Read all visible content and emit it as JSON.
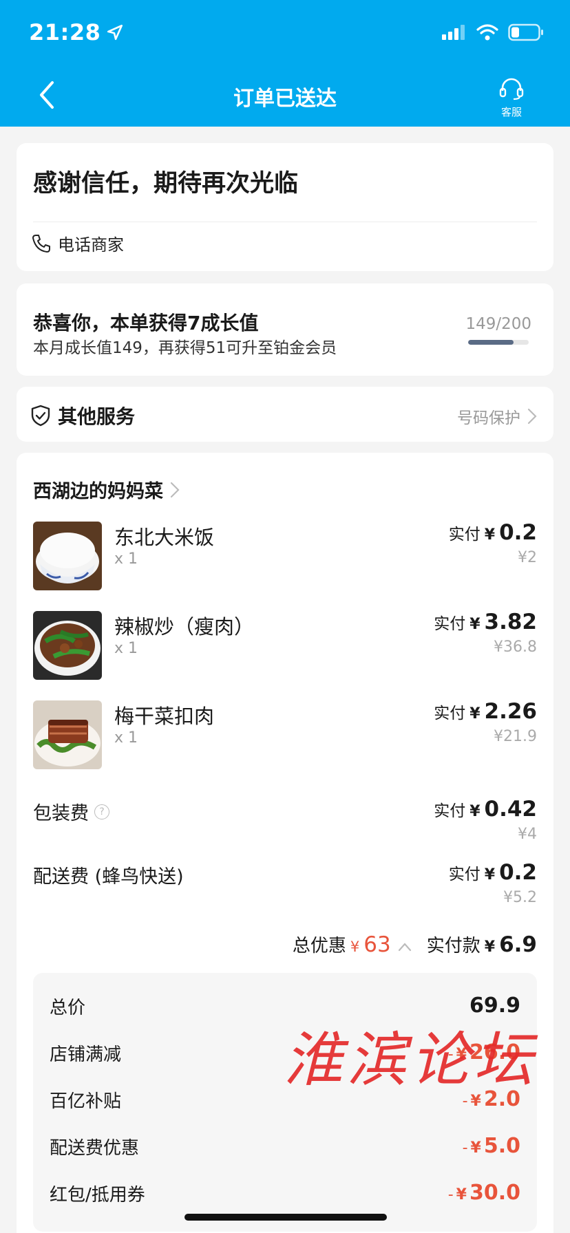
{
  "status_bar": {
    "time": "21:28"
  },
  "nav": {
    "title": "订单已送达",
    "customer_service": "客服"
  },
  "thanks": {
    "title": "感谢信任，期待再次光临",
    "phone_merchant": "电话商家"
  },
  "growth": {
    "title": "恭喜你，本单获得7成长值",
    "subtitle": "本月成长值149，再获得51可升至铂金会员",
    "progress_text": "149/200",
    "progress_fraction": 0.745
  },
  "service": {
    "label": "其他服务",
    "number_protection": "号码保护"
  },
  "order": {
    "shop_name": "西湖边的妈妈菜",
    "paid_label": "实付",
    "yen": "¥",
    "items": [
      {
        "name": "东北大米饭",
        "qty": "x 1",
        "paid": "0.2",
        "original": "¥2"
      },
      {
        "name": "辣椒炒（瘦肉）",
        "qty": "x 1",
        "paid": "3.82",
        "original": "¥36.8"
      },
      {
        "name": "梅干菜扣肉",
        "qty": "x 1",
        "paid": "2.26",
        "original": "¥21.9"
      }
    ],
    "fees": [
      {
        "name": "包装费",
        "paid": "0.42",
        "original": "¥4",
        "help": "?"
      },
      {
        "name": "配送费 (蜂鸟快送)",
        "paid": "0.2",
        "original": "¥5.2"
      }
    ],
    "totals": {
      "discount_label": "总优惠",
      "discount_value": "63",
      "net_label": "实付款",
      "net_value": "6.9"
    },
    "breakdown": [
      {
        "label": "总价",
        "value": "69.9",
        "negative": false
      },
      {
        "label": "店铺满减",
        "value": "26.0",
        "negative": true
      },
      {
        "label": "百亿补贴",
        "value": "2.0",
        "negative": true
      },
      {
        "label": "配送费优惠",
        "value": "5.0",
        "negative": true
      },
      {
        "label": "红包/抵用券",
        "value": "30.0",
        "negative": true
      }
    ],
    "minus_sign": "-"
  },
  "watermark": "淮滨论坛",
  "colors": {
    "header": "#01aaee",
    "discount_red": "#e8543b",
    "progress": "#5a6b85"
  }
}
